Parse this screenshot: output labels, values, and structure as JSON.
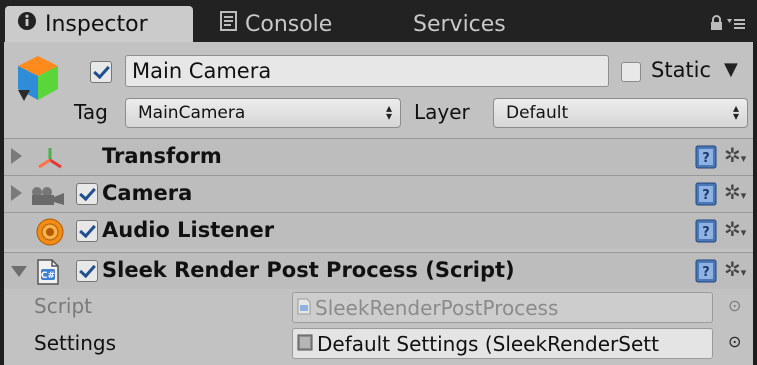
{
  "tabs": [
    {
      "label": "Inspector",
      "icon": "info-icon",
      "active": true
    },
    {
      "label": "Console",
      "icon": "console-icon",
      "active": false
    },
    {
      "label": "Services",
      "active": false
    }
  ],
  "header": {
    "name": "Main Camera",
    "active": true,
    "static_label": "Static",
    "static": false,
    "tag_label": "Tag",
    "tag_value": "MainCamera",
    "layer_label": "Layer",
    "layer_value": "Default"
  },
  "components": [
    {
      "title": "Transform",
      "icon": "transform-axes-icon",
      "has_checkbox": false,
      "expanded": false
    },
    {
      "title": "Camera",
      "icon": "camera-icon",
      "has_checkbox": true,
      "enabled": true,
      "expanded": false
    },
    {
      "title": "Audio Listener",
      "icon": "audio-listener-icon",
      "has_checkbox": true,
      "enabled": true,
      "expanded": false
    },
    {
      "title": "Sleek Render Post Process (Script)",
      "icon": "csharp-script-icon",
      "has_checkbox": true,
      "enabled": true,
      "expanded": true
    }
  ],
  "script_properties": [
    {
      "label": "Script",
      "value": "SleekRenderPostProcess",
      "disabled": true
    },
    {
      "label": "Settings",
      "value": "Default Settings (SleekRenderSett",
      "disabled": false
    }
  ],
  "colors": {
    "tab_bar": "#222222",
    "inspector_bg": "#c2c2c2",
    "check_mark": "#1f4f8f"
  }
}
